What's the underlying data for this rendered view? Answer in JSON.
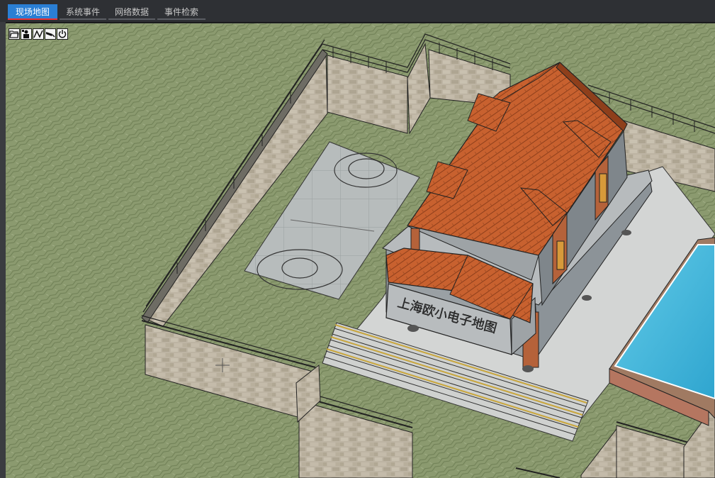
{
  "tabs": [
    {
      "label": "现场地图",
      "active": true
    },
    {
      "label": "系统事件",
      "active": false
    },
    {
      "label": "网络数据",
      "active": false
    },
    {
      "label": "事件检索",
      "active": false
    }
  ],
  "toolbar": {
    "icons": [
      "folder-open-icon",
      "person-camera-icon",
      "line-measure-icon",
      "camera-icon",
      "power-icon"
    ]
  },
  "map": {
    "building_sign": "上海欧小电子地图"
  },
  "colors": {
    "tab_active": "#2a7fd4",
    "tab_active_underline": "#ee3333",
    "grass": "#8b9a6f",
    "wall": "#b9b09f",
    "roof": "#c8612f",
    "pool": "#3fb5d8"
  }
}
